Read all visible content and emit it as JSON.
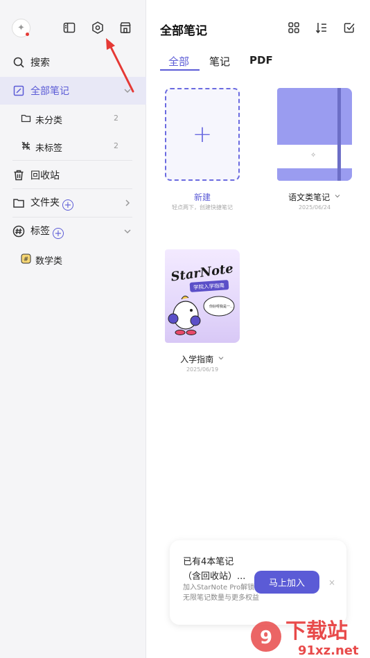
{
  "sidebar": {
    "search_label": "搜索",
    "all_notes_label": "全部笔记",
    "uncategorized": {
      "label": "未分类",
      "count": "2"
    },
    "untagged": {
      "label": "未标签",
      "count": "2"
    },
    "trash_label": "回收站",
    "folders_label": "文件夹",
    "tags_label": "标签",
    "tag_items": [
      {
        "label": "数学类"
      }
    ]
  },
  "main": {
    "title": "全部笔记",
    "tabs": [
      {
        "label": "全部"
      },
      {
        "label": "笔记"
      },
      {
        "label": "PDF"
      }
    ],
    "new_card": {
      "label": "新建",
      "hint": "轻点两下，创建快捷笔记"
    },
    "notebooks": [
      {
        "label": "语文类笔记",
        "date": "2025/06/24"
      },
      {
        "label": "入学指南",
        "date": "2025/06/19",
        "cover_title": "StarNote",
        "cover_subtitle": "学院入学指南",
        "cover_bubble": "你好呀我是一…"
      }
    ]
  },
  "promo": {
    "line1": "已有4本笔记",
    "line2": "（含回收站）...",
    "desc": "加入StarNote Pro解锁无限笔记数量与更多权益",
    "button_label": "马上加入",
    "close_glyph": "×"
  },
  "watermark": {
    "text1": "下载站",
    "text2": "91xz.net"
  },
  "colors": {
    "accent": "#5b5bd6",
    "sidebar_bg": "#f5f5f7",
    "notebook_cover": "#9a9cf0",
    "annotation_arrow": "#e53935"
  }
}
